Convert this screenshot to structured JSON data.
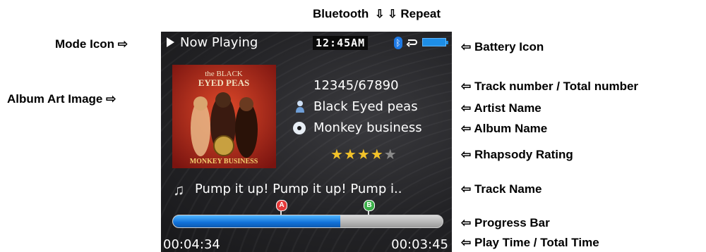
{
  "annotations": {
    "bluetooth": "Bluetooth",
    "repeat": "Repeat",
    "mode_icon": "Mode Icon",
    "album_art": "Album Art Image",
    "battery": "Battery Icon",
    "track_number": "Track number / Total number",
    "artist_name": "Artist Name",
    "album_name": "Album Name",
    "rating": "Rhapsody Rating",
    "track_name": "Track Name",
    "progress_bar": "Progress Bar",
    "play_time": "Play Time / Total Time"
  },
  "screen": {
    "mode_title": "Now Playing",
    "clock": "12:45AM",
    "track_number": "12345/67890",
    "artist": "Black Eyed peas",
    "album": "Monkey business",
    "track_name": "Pump it up! Pump it up! Pump i..",
    "rating": 4,
    "rating_max": 5,
    "marker_a": "A",
    "marker_b": "B",
    "progress": 0.62,
    "play_time": "00:04:34",
    "total_time": "00:03:45",
    "album_art_text": [
      "the BLACK",
      "EYED PEAS",
      "MONKEY BUSINESS"
    ]
  },
  "colors": {
    "accent_blue": "#1e7ae6",
    "star_on": "#f2c22a",
    "star_off": "#8a8a8a",
    "marker_a": "#e53a3a",
    "marker_b": "#3cb04a"
  },
  "icons": [
    "play-icon",
    "bluetooth-icon",
    "repeat-icon",
    "battery-icon",
    "artist-icon",
    "album-disc-icon",
    "music-note-icon",
    "arrow-right-icon",
    "arrow-left-icon",
    "arrow-down-icon"
  ]
}
